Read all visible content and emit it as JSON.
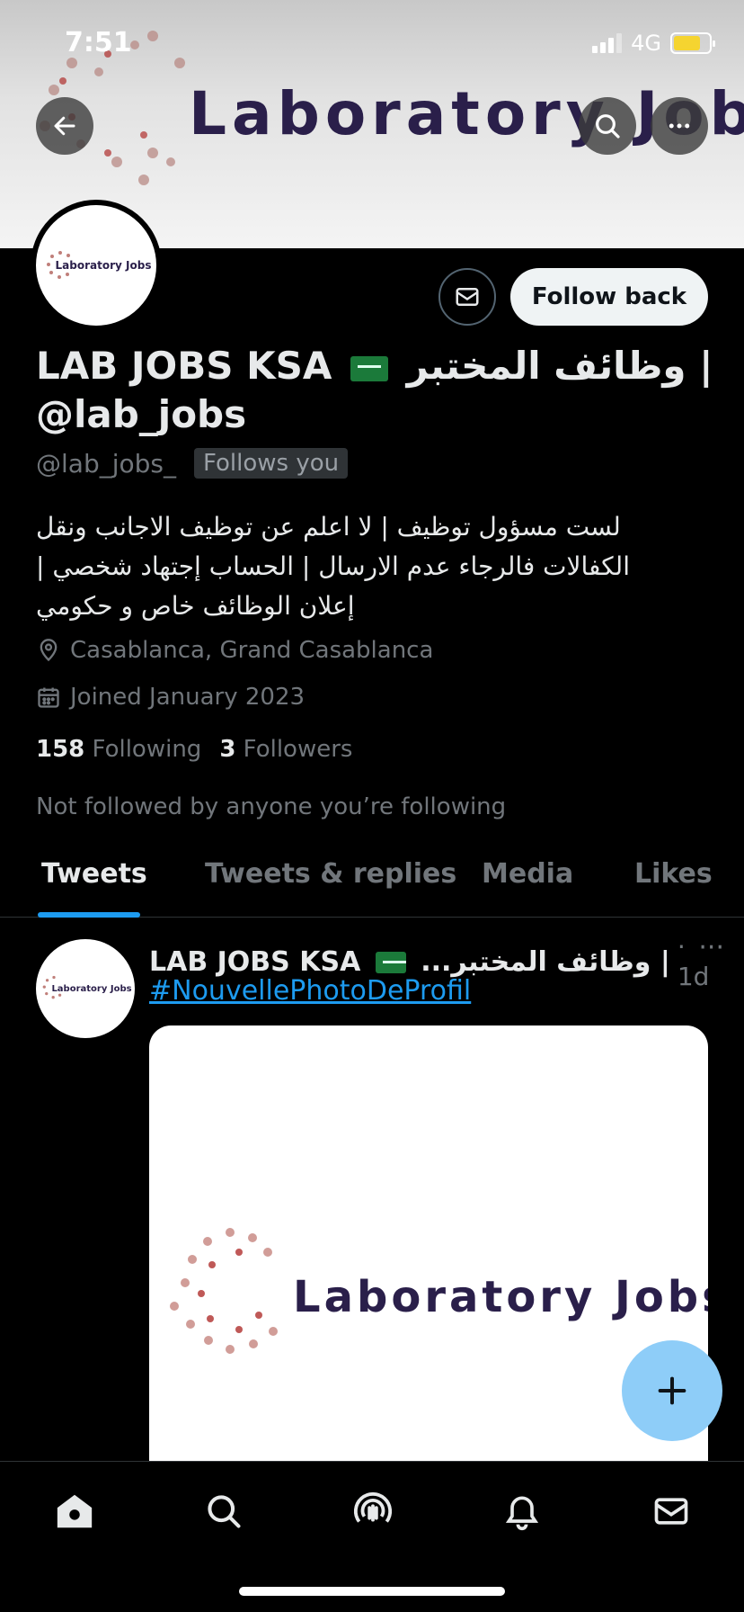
{
  "status_bar": {
    "time": "7:51",
    "network": "4G"
  },
  "banner": {
    "title": "Laboratory Jobs"
  },
  "profile": {
    "name_prefix": "LAB JOBS KSA",
    "name_arabic": "| وظائف المختبر",
    "name_line2": "@lab_jobs",
    "handle": "@lab_jobs_",
    "follows_you": "Follows you",
    "bio": "لست مسؤول توظيف | لا اعلم عن توظيف الاجانب ونقل الكفالات فالرجاء عدم الارسال | الحساب إجتهاد شخصي | إعلان الوظائف خاص و حكومي",
    "location": "Casablanca, Grand Casablanca",
    "joined": "Joined January 2023",
    "following_count": "158",
    "following_label": "Following",
    "followers_count": "3",
    "followers_label": "Followers",
    "not_followed": "Not followed by anyone you’re following",
    "avatar_text": "Laboratory Jobs"
  },
  "actions": {
    "follow_back": "Follow back"
  },
  "tabs": [
    "Tweets",
    "Tweets & replies",
    "Media",
    "Likes"
  ],
  "tweet": {
    "name": "LAB JOBS KSA",
    "name_arabic": "| وظائف المختبر...",
    "time": "· 1d",
    "more": "···",
    "hashtag": "#NouvellePhotoDeProfil",
    "image_text": "Laboratory Jobs",
    "avatar_text": "Laboratory Jobs"
  },
  "colors": {
    "accent": "#1d9bf0",
    "fab": "#8ecdf8",
    "background": "#000000"
  },
  "icons": [
    "back-arrow-icon",
    "search-icon",
    "more-icon",
    "mail-icon",
    "location-icon",
    "calendar-icon",
    "plus-icon",
    "home-icon",
    "explore-icon",
    "spaces-icon",
    "notifications-icon",
    "messages-icon"
  ]
}
